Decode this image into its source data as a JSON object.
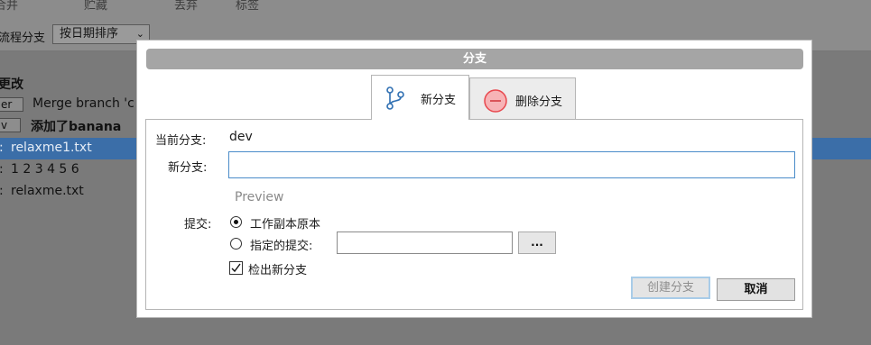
{
  "toolbar": {
    "items": [
      "合并",
      "贮藏",
      "丢弃",
      "标签"
    ]
  },
  "filterbar": {
    "label": "流程分支",
    "sort_select": "按日期排序"
  },
  "background_list": {
    "section_title": "更改",
    "rows": [
      {
        "tag": "er",
        "text": "Merge branch 'c"
      },
      {
        "tag": "v",
        "text": "添加了banana"
      },
      {
        "prefix": ":",
        "text": "relaxme1.txt"
      },
      {
        "prefix": ":",
        "text": "1 2 3 4 5 6"
      },
      {
        "prefix": ":",
        "text": "relaxme.txt"
      }
    ]
  },
  "dialog": {
    "title": "分支",
    "tabs": [
      {
        "label": "新分支",
        "icon": "branch-icon",
        "active": true
      },
      {
        "label": "删除分支",
        "icon": "minus-circle-icon",
        "active": false
      }
    ],
    "current_branch_label": "当前分支:",
    "current_branch_value": "dev",
    "new_branch_label": "新分支:",
    "new_branch_value": "",
    "preview_label": "Preview",
    "commit_label": "提交:",
    "options": {
      "working_copy": "工作副本原本",
      "specified_commit": "指定的提交:",
      "selected": "working_copy"
    },
    "specified_commit_value": "",
    "browse_button": "...",
    "checkout_label": "检出新分支",
    "checkout_checked": true,
    "buttons": {
      "create": "创建分支",
      "cancel": "取消"
    }
  },
  "colors": {
    "selection": "#3b6ea8",
    "accent_border": "#4a8cc9",
    "delete_icon": "#e8484e"
  }
}
